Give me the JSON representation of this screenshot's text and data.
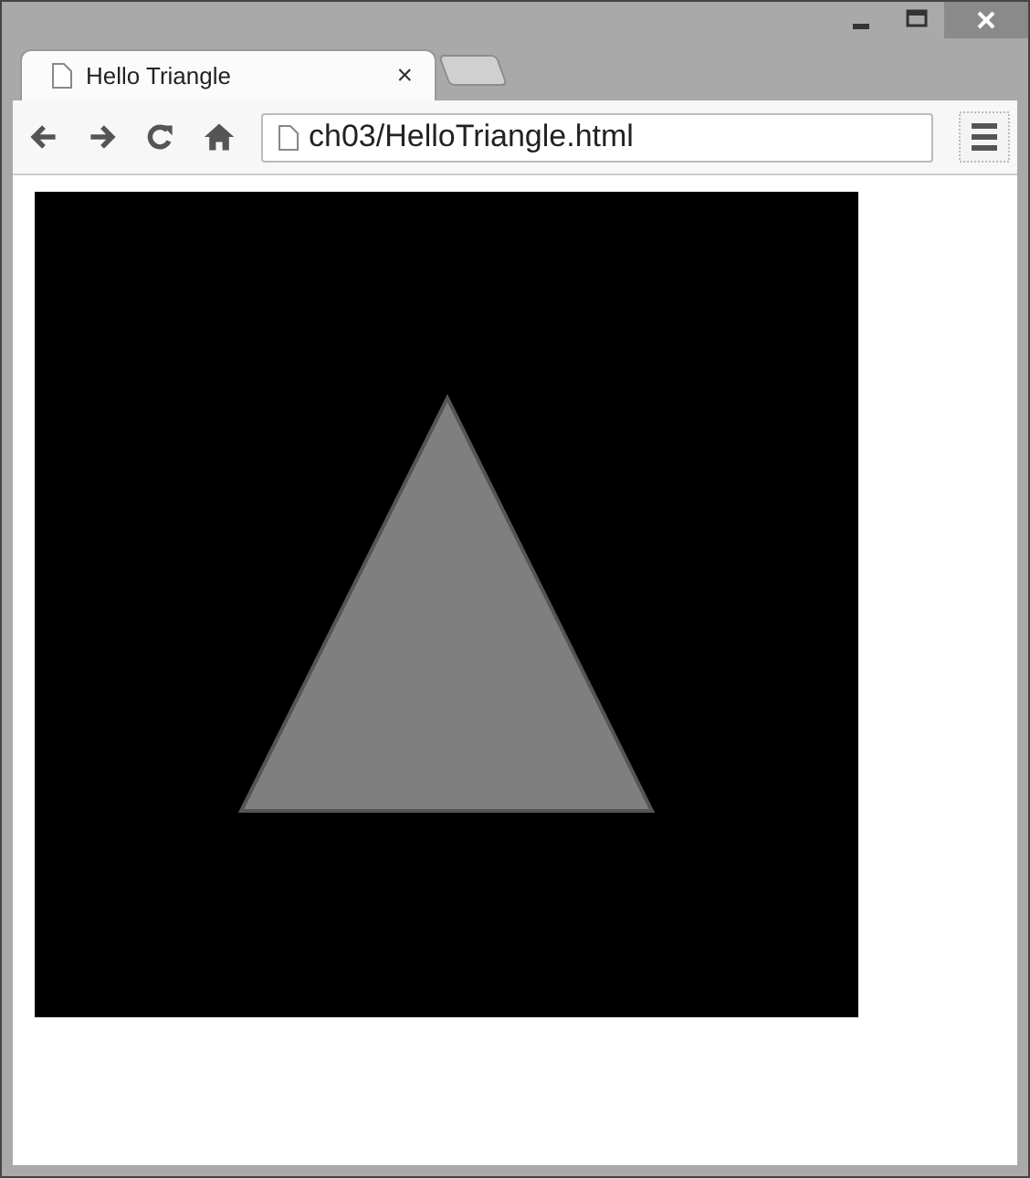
{
  "window": {
    "controls": [
      {
        "kind": "minimize"
      },
      {
        "kind": "maximize"
      },
      {
        "kind": "close"
      }
    ]
  },
  "tabs": [
    {
      "title": "Hello Triangle",
      "close": "×",
      "selected": true
    }
  ],
  "toolbar": {
    "address": "ch03/HelloTriangle.html"
  },
  "content": {
    "kind": "triangle"
  }
}
